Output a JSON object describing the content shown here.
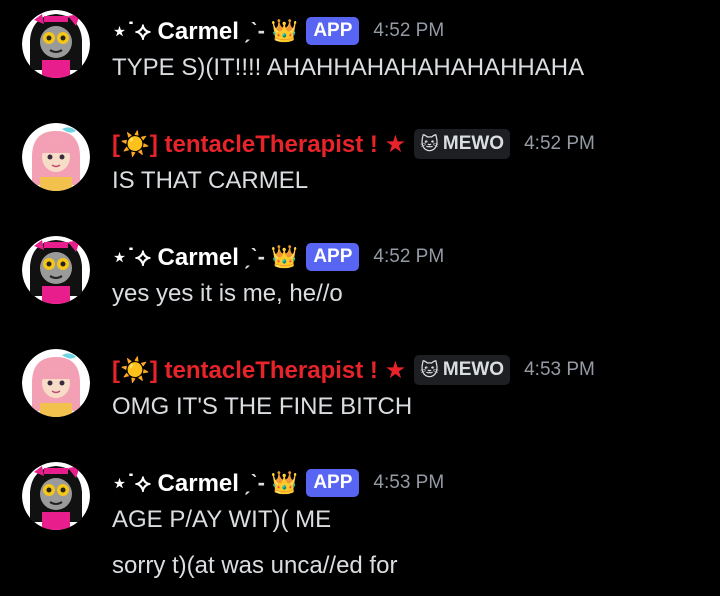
{
  "colors": {
    "background": "#000000",
    "message_text": "#dbdee1",
    "timestamp": "#949ba4",
    "carmel_name": "#ffffff",
    "tentacle_name": "#e8232a",
    "app_badge": "#5865f2",
    "mewo_badge": "#1e1f22"
  },
  "messages": [
    {
      "author": "⋆˙⟡ Carmel",
      "squiggle": "ˏˋ-",
      "crown_icon": "👑",
      "badge": "APP",
      "time": "4:52 PM",
      "lines": [
        "TYPE S)(IT!!!! AHAHHAHAHAHAHAHHAHA"
      ]
    },
    {
      "author": "[☀️] tentacleTherapist ! ★",
      "badge_icon": "🐱",
      "badge": "MEWO",
      "time": "4:52 PM",
      "lines": [
        "IS THAT CARMEL"
      ]
    },
    {
      "author": "⋆˙⟡ Carmel",
      "squiggle": "ˏˋ-",
      "crown_icon": "👑",
      "badge": "APP",
      "time": "4:52 PM",
      "lines": [
        "yes yes it is me, he//o"
      ]
    },
    {
      "author": "[☀️] tentacleTherapist ! ★",
      "badge_icon": "🐱",
      "badge": "MEWO",
      "time": "4:53 PM",
      "lines": [
        "OMG IT'S THE FINE BITCH"
      ]
    },
    {
      "author": "⋆˙⟡ Carmel",
      "squiggle": "ˏˋ-",
      "crown_icon": "👑",
      "badge": "APP",
      "time": "4:53 PM",
      "lines": [
        "AGE P/AY WIT)( ME",
        "sorry t)(at was unca//ed for"
      ]
    }
  ]
}
